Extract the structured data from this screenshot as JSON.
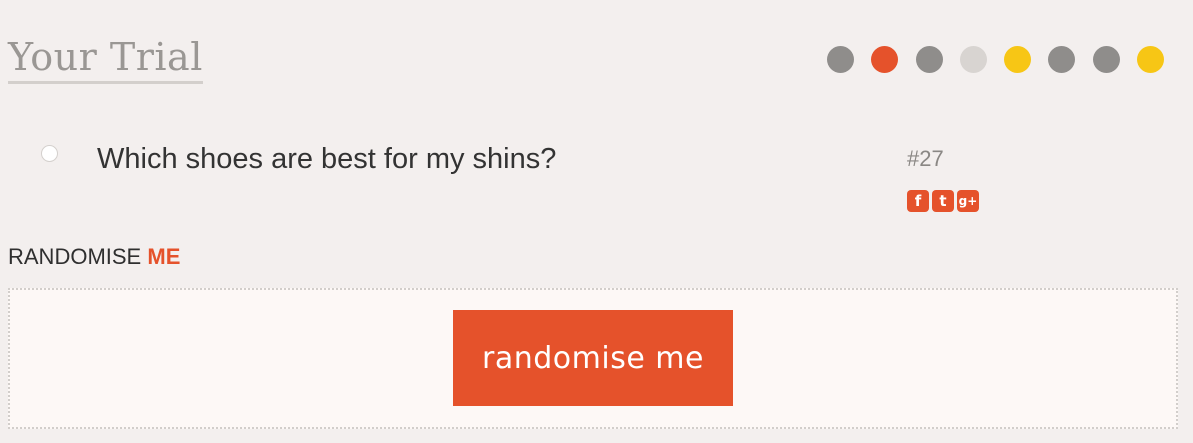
{
  "header": {
    "title": "Your Trial",
    "progress_dots": [
      {
        "color": "#8f8d8b"
      },
      {
        "color": "#e5522b"
      },
      {
        "color": "#8f8d8b"
      },
      {
        "color": "#d8d4d1"
      },
      {
        "color": "#f7c615"
      },
      {
        "color": "#8f8d8b"
      },
      {
        "color": "#8f8d8b"
      },
      {
        "color": "#f7c615"
      }
    ]
  },
  "question": {
    "text": "Which shoes are best for my shins?",
    "number": "#27",
    "share": [
      {
        "icon": "facebook-icon",
        "glyph": "f"
      },
      {
        "icon": "twitter-icon",
        "glyph": "t"
      },
      {
        "icon": "google-plus-icon",
        "glyph": "g+"
      }
    ]
  },
  "randomise": {
    "heading_prefix": "RANDOMISE",
    "heading_accent": "ME",
    "button_label": "randomise me"
  },
  "colors": {
    "accent": "#e5522b",
    "background": "#f3efee"
  }
}
